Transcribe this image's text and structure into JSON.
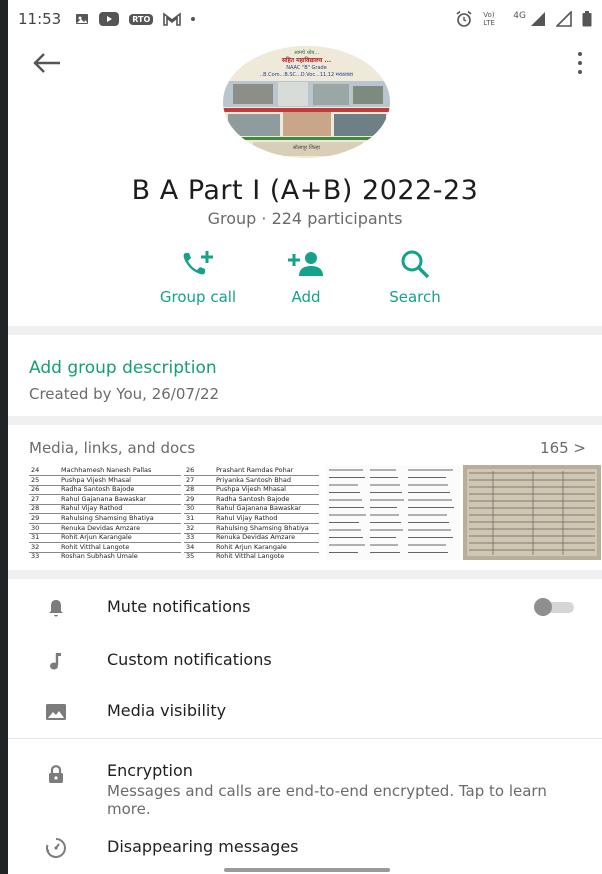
{
  "status_bar": {
    "time": "11:53",
    "rto_badge": "RTO",
    "network_label": "Vo) LTE",
    "network_type": "4G"
  },
  "group": {
    "name": "B A Part I (A+B) 2022-23",
    "subtitle": "Group · 224 participants",
    "avatar_lines": {
      "top_small": "आमचे ध्येय...",
      "college_name": "सहित महाविद्यालय ...",
      "grade": "NAAC \"B\" Grade",
      "courses": "..B.Com...B.SC...D.Voc...11,12 मराठवाडा",
      "footer": "सोलापूर जिल्हा"
    }
  },
  "actions": [
    {
      "label": "Group call",
      "icon": "group-call-icon"
    },
    {
      "label": "Add",
      "icon": "add-person-icon"
    },
    {
      "label": "Search",
      "icon": "search-icon"
    }
  ],
  "description": {
    "add_label": "Add group description",
    "created": "Created by You, 26/07/22"
  },
  "media": {
    "header": "Media, links, and docs",
    "count": "165 >",
    "thumb1_rows": [
      {
        "n": "24",
        "name": "Machhamesh Nanesh Pallas"
      },
      {
        "n": "25",
        "name": "Pushpa Vijesh Mhasal"
      },
      {
        "n": "26",
        "name": "Radha Santosh Bajode"
      },
      {
        "n": "27",
        "name": "Rahul Gajanana Bawaskar"
      },
      {
        "n": "28",
        "name": "Rahul Vijay Rathod"
      },
      {
        "n": "29",
        "name": "Rahulsing Shamsing Bhatiya"
      },
      {
        "n": "30",
        "name": "Renuka Devidas Amzare"
      },
      {
        "n": "31",
        "name": "Rohit Arjun Karangale"
      },
      {
        "n": "32",
        "name": "Rohit Vitthal Langote"
      },
      {
        "n": "33",
        "name": "Roshan Subhash Umale"
      }
    ],
    "thumb2_rows": [
      {
        "n": "26",
        "name": "Prashant Ramdas Pohar"
      },
      {
        "n": "27",
        "name": "Priyanka Santosh Bhad"
      },
      {
        "n": "28",
        "name": "Pushpa Vijesh Mhasal"
      },
      {
        "n": "29",
        "name": "Radha Santosh Bajode"
      },
      {
        "n": "30",
        "name": "Rahul Gajanana Bawaskar"
      },
      {
        "n": "31",
        "name": "Rahul Vijay Rathod"
      },
      {
        "n": "32",
        "name": "Rahulsing Shamsing Bhatiya"
      },
      {
        "n": "33",
        "name": "Renuka Devidas Amzare"
      },
      {
        "n": "34",
        "name": "Rohit Arjun Karangale"
      },
      {
        "n": "35",
        "name": "Rohit Vitthal Langote"
      }
    ]
  },
  "settings": [
    {
      "label": "Mute notifications",
      "icon": "bell-icon"
    },
    {
      "label": "Custom notifications",
      "icon": "music-note-icon"
    },
    {
      "label": "Media visibility",
      "icon": "image-icon"
    }
  ],
  "mute_toggle": {
    "on": false
  },
  "encryption": {
    "title": "Encryption",
    "subtitle": "Messages and calls are end-to-end encrypted. Tap to learn more."
  },
  "disappearing": {
    "label": "Disappearing messages"
  },
  "colors": {
    "accent": "#14a28a",
    "link": "#149e73",
    "text": "#1f1f1f",
    "muted": "#6b6b6b",
    "separator": "#f0f0f0"
  }
}
